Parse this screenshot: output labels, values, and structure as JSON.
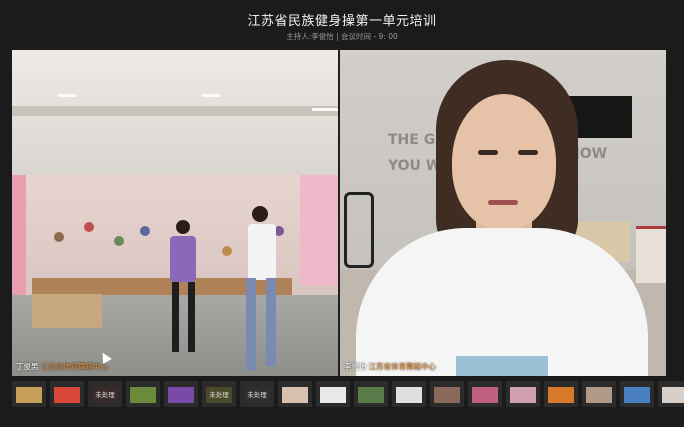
{
  "meeting": {
    "title": "江苏省民族健身操第一单元培训",
    "subtitle": "主持人:李俊怡 | 会议时间 - 9: 00"
  },
  "participants": [
    {
      "name": "丁俊男",
      "org": "江苏省体育舞蹈中心"
    },
    {
      "name": "李俊怡",
      "org": "江苏省体育舞蹈中心"
    }
  ],
  "background_wall_text": [
    "THE GR",
    "YOU WAN",
    "NOW"
  ],
  "thumbnails": [
    {
      "color": "#c9a05a",
      "label": ""
    },
    {
      "color": "#d8483a",
      "label": ""
    },
    {
      "color": "#3a2a2a",
      "label": "未处理"
    },
    {
      "color": "#6b8a3a",
      "label": ""
    },
    {
      "color": "#7a4aa8",
      "label": ""
    },
    {
      "color": "#4a4a2a",
      "label": "未处理"
    },
    {
      "color": "#2f2f2f",
      "label": "未处理"
    },
    {
      "color": "#d8c0b0",
      "label": ""
    },
    {
      "color": "#e8e8e8",
      "label": ""
    },
    {
      "color": "#5a7a4a",
      "label": ""
    },
    {
      "color": "#e0e0e0",
      "label": ""
    },
    {
      "color": "#8a6a5a",
      "label": ""
    },
    {
      "color": "#c06080",
      "label": ""
    },
    {
      "color": "#d0a0b0",
      "label": ""
    },
    {
      "color": "#d87a2a",
      "label": ""
    },
    {
      "color": "#b09a8a",
      "label": ""
    },
    {
      "color": "#4a80c0",
      "label": ""
    },
    {
      "color": "#d8d0c8",
      "label": ""
    }
  ]
}
